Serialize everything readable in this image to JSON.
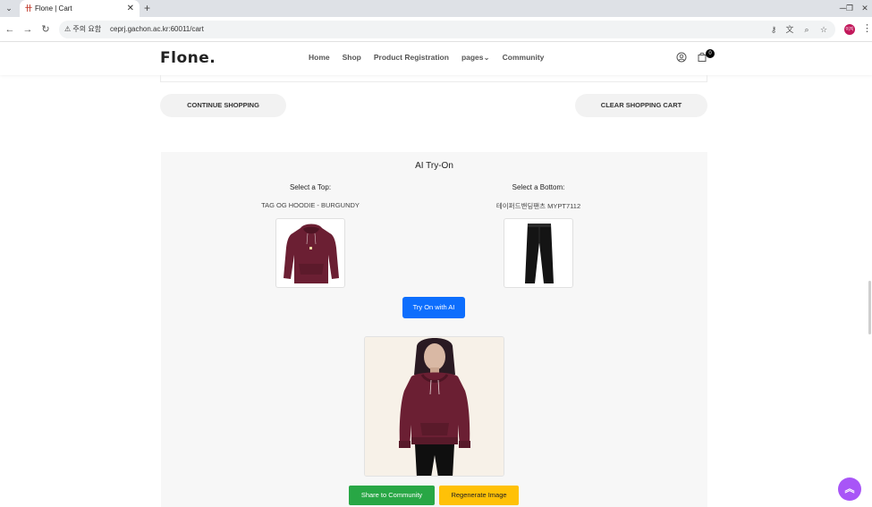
{
  "browser": {
    "tab_title": "Flone | Cart",
    "favicon_char": "卄",
    "new_tab_label": "+",
    "tab_close_label": "✕",
    "security_label": "⚠ 주의 요함",
    "url": "ceprj.gachon.ac.kr:60011/cart",
    "profile_initials": "이지"
  },
  "site": {
    "logo": "Flone.",
    "nav": [
      "Home",
      "Shop",
      "Product Registration",
      "pages⌄",
      "Community"
    ],
    "cart_count": "0"
  },
  "cart_actions": {
    "continue_label": "CONTINUE SHOPPING",
    "clear_label": "CLEAR SHOPPING CART"
  },
  "tryon": {
    "title": "AI Try-On",
    "top_label": "Select a Top:",
    "top_name": "TAG OG HOODIE - BURGUNDY",
    "bottom_label": "Select a Bottom:",
    "bottom_name": "테이퍼드밴딩팬츠 MYPT7112",
    "try_button": "Try On with AI",
    "share_button": "Share to Community",
    "regenerate_button": "Regenerate Image"
  },
  "colors": {
    "primary": "#0d6efd",
    "success": "#28a745",
    "warning": "#ffc107",
    "hoodie": "#6b1f33",
    "scroll_top": "#a855f7"
  },
  "icons": {
    "scroll_top": "double-chevron-up-icon",
    "user": "user-icon",
    "cart": "cart-icon"
  }
}
